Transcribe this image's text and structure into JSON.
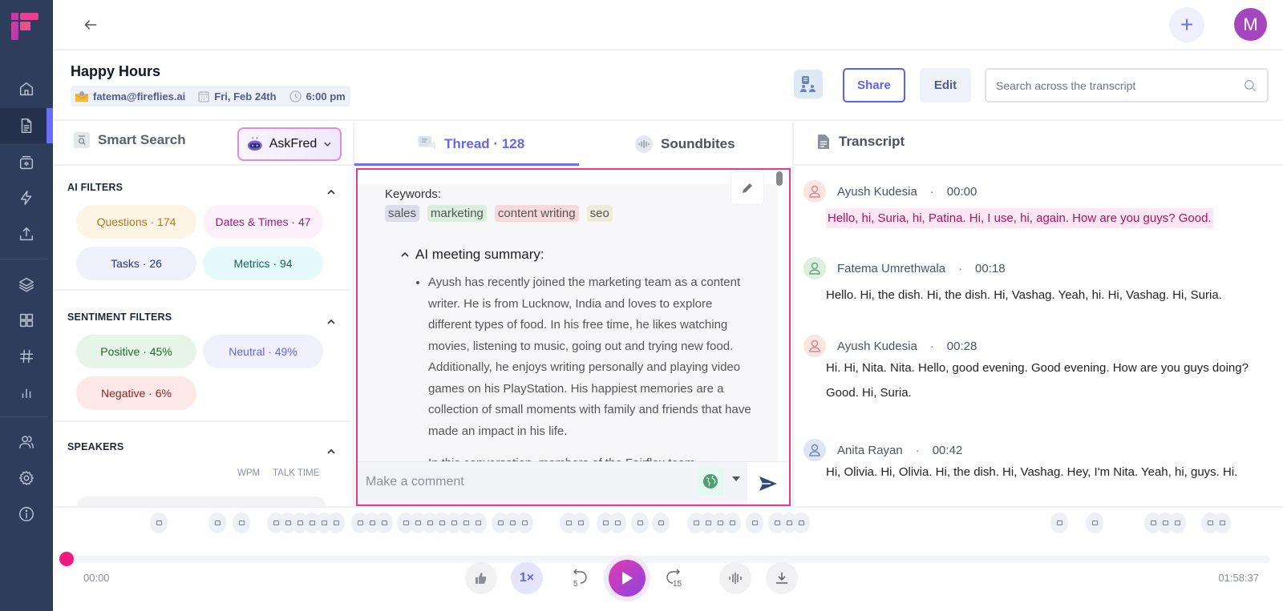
{
  "app": {
    "brand_colors": {
      "sidebar": "#2f3d5c",
      "accent": "#6b6ff7",
      "highlight": "#ea3a8c",
      "avatar": "#a646be"
    }
  },
  "sidebar": {
    "items": [
      {
        "name": "home",
        "icon": "home-icon",
        "active": false
      },
      {
        "name": "meetings",
        "icon": "document-icon",
        "active": true
      },
      {
        "name": "uploads-recorder",
        "icon": "recorder-icon",
        "active": false
      },
      {
        "name": "integrations",
        "icon": "bolt-icon",
        "active": false
      },
      {
        "name": "upload",
        "icon": "upload-icon",
        "active": false
      },
      {
        "name": "channels",
        "icon": "layers-icon",
        "active": false
      },
      {
        "name": "apps",
        "icon": "grid-icon",
        "active": false
      },
      {
        "name": "topics",
        "icon": "hash-icon",
        "active": false
      },
      {
        "name": "analytics",
        "icon": "bar-chart-icon",
        "active": false
      },
      {
        "name": "team",
        "icon": "users-icon",
        "active": false
      },
      {
        "name": "settings",
        "icon": "gear-icon",
        "active": false
      },
      {
        "name": "info",
        "icon": "info-icon",
        "active": false
      }
    ]
  },
  "topbar": {
    "plus_label": "+",
    "avatar_initial": "M"
  },
  "header": {
    "title": "Happy Hours",
    "email": "fatema@fireflies.ai",
    "date": "Fri, Feb 24th",
    "time": "6:00 pm",
    "share_label": "Share",
    "edit_label": "Edit",
    "search_placeholder": "Search across the transcript"
  },
  "left_panel": {
    "smart_search_label": "Smart Search",
    "askfred_label": "AskFred",
    "ai_filters": {
      "title": "AI FILTERS",
      "items": [
        {
          "label": "Questions · 174",
          "bg": "#fef4e4",
          "fg": "#b7790f"
        },
        {
          "label": "Dates & Times · 47",
          "bg": "#fdf0fb",
          "fg": "#a0198a"
        },
        {
          "label": "Tasks · 26",
          "bg": "#eef0fc",
          "fg": "#28347e"
        },
        {
          "label": "Metrics · 94",
          "bg": "#e5fbfb",
          "fg": "#14615e"
        }
      ]
    },
    "sentiment_filters": {
      "title": "SENTIMENT FILTERS",
      "items": [
        {
          "label": "Positive · 45%",
          "bg": "#e6f5e8",
          "fg": "#1d6b25"
        },
        {
          "label": "Neutral · 49%",
          "bg": "#f0f0fd",
          "fg": "#6366f1"
        },
        {
          "label": "Negative · 6%",
          "bg": "#fde8e8",
          "fg": "#9b1c1c"
        }
      ]
    },
    "speakers": {
      "title": "SPEAKERS",
      "col_wpm": "WPM",
      "col_talk_time": "TALK TIME"
    }
  },
  "middle_panel": {
    "tabs": [
      {
        "label": "Thread · 128",
        "active": true
      },
      {
        "label": "Soundbites",
        "active": false
      }
    ],
    "keywords_label": "Keywords:",
    "keywords": [
      {
        "label": "sales",
        "bg": "#dcdcec"
      },
      {
        "label": "marketing",
        "bg": "#d9efdd"
      },
      {
        "label": "content writing",
        "bg": "#f7d9d9"
      },
      {
        "label": "seo",
        "bg": "#ececd9"
      }
    ],
    "summary_title": "AI meeting summary:",
    "summary_bullets": [
      "Ayush has recently joined the marketing team as a content writer. He is from Lucknow, India and loves to explore different types of food. In his free time, he likes watching movies, listening to music, going out and trying new food. Additionally, he enjoys writing personally and playing video games on his PlayStation. His happiest memories are a collection of small moments with family and friends that have made an impact in his life."
    ],
    "next_line": "In this conversation, members of the Fairflex team",
    "comment_placeholder": "Make a comment"
  },
  "right_panel": {
    "title": "Transcript",
    "entries": [
      {
        "speaker": "Ayush Kudesia",
        "time": "00:00",
        "text": "Hello, hi, Suria, hi, Patina. Hi, I use, hi, again. How are you guys? Good.",
        "highlighted": true,
        "avatar_bg": "#fbe4e4",
        "avatar_fg": "#d48a8a"
      },
      {
        "speaker": "Fatema Umrethwala",
        "time": "00:18",
        "text": "Hello. Hi, the dish. Hi, the dish. Hi, Vashag. Yeah, hi. Hi, Vashag. Hi, Suria.",
        "highlighted": false,
        "avatar_bg": "#dcefe0",
        "avatar_fg": "#6aa67a"
      },
      {
        "speaker": "Ayush Kudesia",
        "time": "00:28",
        "text": "Hi. Hi, Nita. Nita. Hello, good evening. Good evening. How are you guys doing? Good. Hi, Suria.",
        "highlighted": false,
        "avatar_bg": "#fbe4e4",
        "avatar_fg": "#d48a8a"
      },
      {
        "speaker": "Anita Rayan",
        "time": "00:42",
        "text": "Hi, Olivia. Hi, Olivia. Hi, the dish. Hi, Vashag. Hey, I'm Nita. Yeah, hi, guys. Hi.",
        "highlighted": false,
        "avatar_bg": "#dde6f4",
        "avatar_fg": "#7189b3"
      }
    ]
  },
  "player": {
    "current_time": "00:00",
    "total_time": "01:58:37",
    "progress": 0,
    "speed_label": "1×",
    "rewind_seconds": "5",
    "forward_seconds": "15",
    "comment_markers_x": [
      132,
      205,
      235,
      278,
      293,
      308,
      323,
      338,
      353,
      383,
      398,
      413,
      440,
      455,
      470,
      485,
      500,
      515,
      530,
      558,
      573,
      588,
      643,
      658,
      689,
      704,
      732,
      758,
      802,
      817,
      832,
      847,
      875,
      903,
      918,
      933,
      1255,
      1299,
      1372,
      1387,
      1402,
      1443,
      1458
    ]
  }
}
